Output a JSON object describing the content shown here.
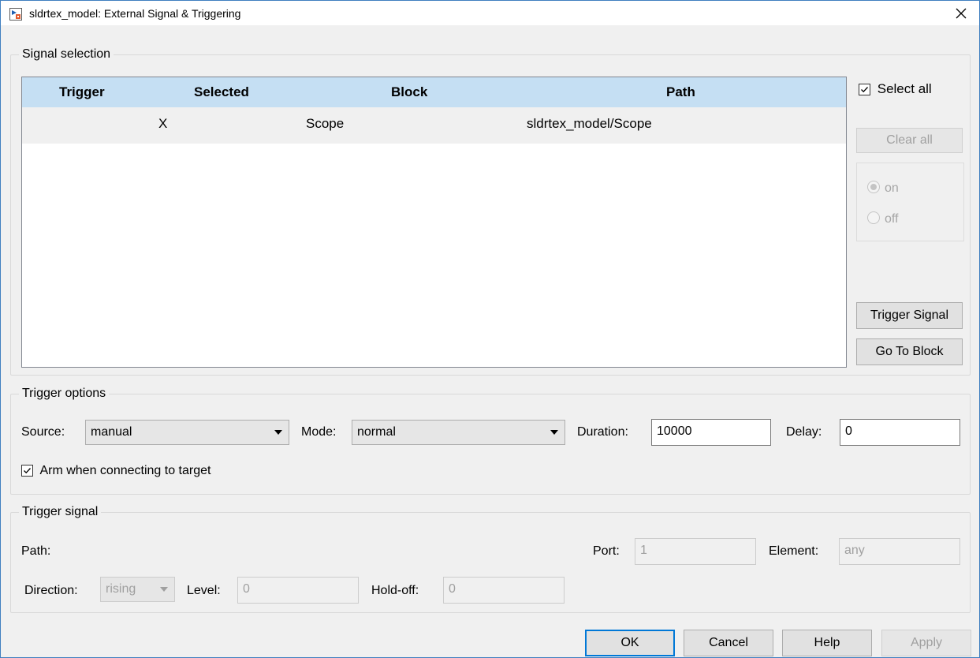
{
  "window": {
    "title": "sldrtex_model: External Signal & Triggering"
  },
  "signal_selection": {
    "legend": "Signal selection",
    "columns": [
      "Trigger",
      "Selected",
      "Block",
      "Path"
    ],
    "rows": [
      {
        "trigger": "",
        "selected": "X",
        "block": "Scope",
        "path": "sldrtex_model/Scope"
      }
    ],
    "select_all_label": "Select all",
    "select_all_checked": true,
    "clear_all_label": "Clear all",
    "radio_on_label": "on",
    "radio_off_label": "off",
    "trigger_signal_label": "Trigger Signal",
    "go_to_block_label": "Go To Block"
  },
  "trigger_options": {
    "legend": "Trigger options",
    "source_label": "Source:",
    "source_value": "manual",
    "mode_label": "Mode:",
    "mode_value": "normal",
    "duration_label": "Duration:",
    "duration_value": "10000",
    "delay_label": "Delay:",
    "delay_value": "0",
    "arm_label": "Arm when connecting to target",
    "arm_checked": true
  },
  "trigger_signal": {
    "legend": "Trigger signal",
    "path_label": "Path:",
    "port_label": "Port:",
    "port_value": "1",
    "element_label": "Element:",
    "element_value": "any",
    "direction_label": "Direction:",
    "direction_value": "rising",
    "level_label": "Level:",
    "level_value": "0",
    "holdoff_label": "Hold-off:",
    "holdoff_value": "0"
  },
  "footer": {
    "ok": "OK",
    "cancel": "Cancel",
    "help": "Help",
    "apply": "Apply"
  },
  "colors": {
    "header_bg": "#c5dff3",
    "accent": "#0078d7"
  }
}
